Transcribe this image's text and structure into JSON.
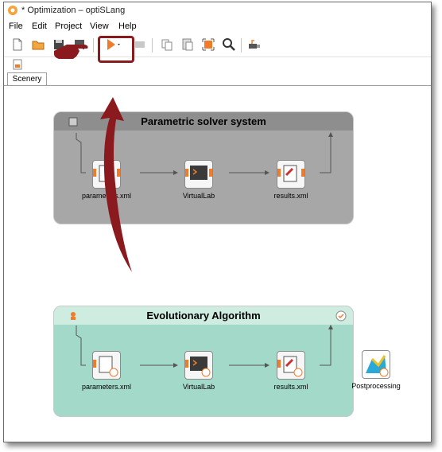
{
  "window": {
    "title": "* Optimization – optiSLang"
  },
  "menu": {
    "items": [
      "File",
      "Edit",
      "Project",
      "View",
      "Help"
    ]
  },
  "tabs": [
    {
      "label": "Scenery"
    }
  ],
  "parametric_system": {
    "title": "Parametric solver system",
    "nodes": [
      {
        "label": "parameters.xml"
      },
      {
        "label": "VirtualLab"
      },
      {
        "label": "results.xml"
      }
    ]
  },
  "evolutionary_system": {
    "title": "Evolutionary Algorithm",
    "nodes": [
      {
        "label": "parameters.xml"
      },
      {
        "label": "VirtualLab"
      },
      {
        "label": "results.xml"
      }
    ]
  },
  "postprocessing": {
    "label": "Postprocessing"
  },
  "colors": {
    "parametric_bg": "#a7a7a7",
    "parametric_head": "#8e8e8e",
    "evolutionary_bg": "#a3d9c8",
    "evolutionary_head": "#cfece1",
    "annotation": "#8b1a1f",
    "run_arrow": "#f07b2a"
  }
}
